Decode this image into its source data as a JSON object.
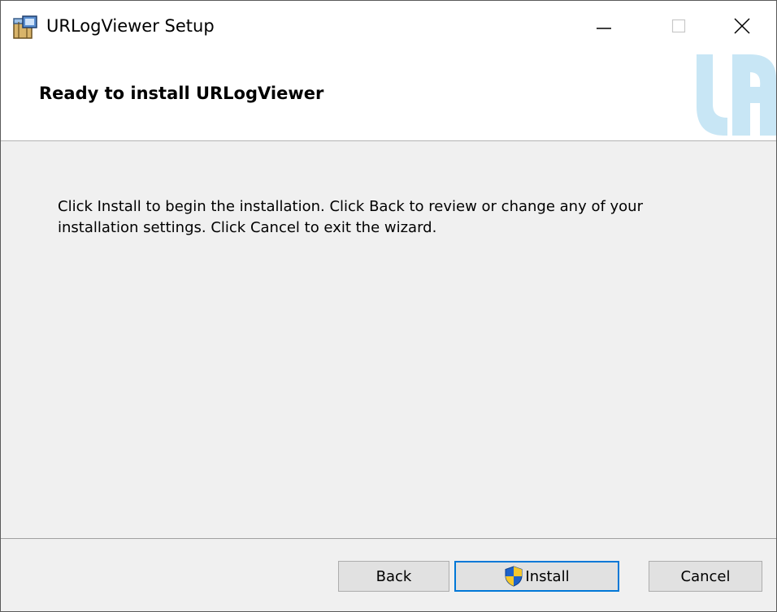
{
  "window": {
    "title": "URLogViewer Setup"
  },
  "titlebar": {
    "icons": {
      "app": "installer-package-icon",
      "minimize": "minimize-icon",
      "maximize": "maximize-icon",
      "close": "close-icon"
    }
  },
  "banner": {
    "title": "Ready to install URLogViewer",
    "logo": "ur-logo"
  },
  "body": {
    "message": "Click Install to begin the installation. Click Back to review or change any of your installation settings. Click Cancel to exit the wizard."
  },
  "footer": {
    "back_label": "Back",
    "install_label": "Install",
    "install_icon": "uac-shield-icon",
    "cancel_label": "Cancel"
  },
  "colors": {
    "accent": "#0078d7",
    "background": "#f0f0f0",
    "logo": "#c8e6f5"
  }
}
